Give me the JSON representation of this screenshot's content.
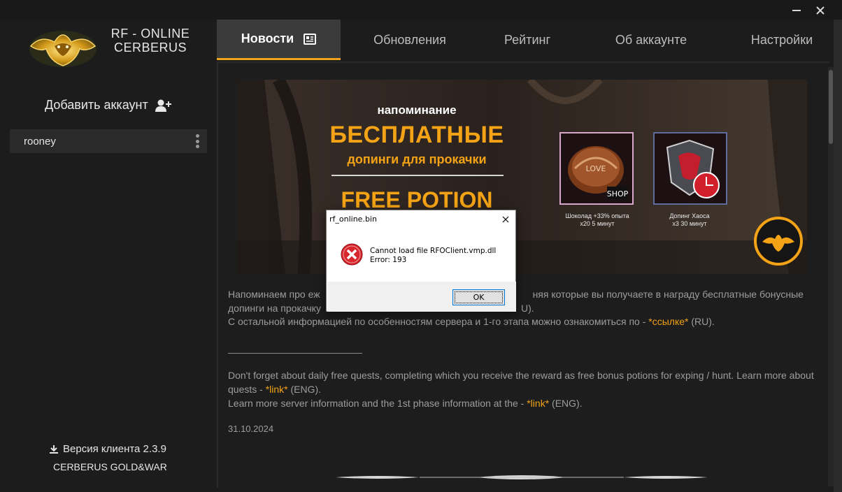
{
  "app": {
    "brand_line1": "RF - ONLINE",
    "brand_line2": "CERBERUS",
    "colors": {
      "accent": "#f3a315",
      "background": "#1c1c1c",
      "tab_active_bg": "#3b3b3b"
    }
  },
  "sidebar": {
    "add_account_label": "Добавить аккаунт",
    "accounts": [
      {
        "name": "rooney"
      }
    ],
    "version_label": "Версия клиента 2.3.9",
    "server_label": "CERBERUS GOLD&WAR"
  },
  "tabs": [
    {
      "label": "Новости",
      "active": true,
      "icon": "newspaper-icon"
    },
    {
      "label": "Обновления",
      "active": false
    },
    {
      "label": "Рейтинг",
      "active": false
    },
    {
      "label": "Об аккаунте",
      "active": false
    },
    {
      "label": "Настройки",
      "active": false
    }
  ],
  "banner": {
    "reminder": "напоминание",
    "free": "БЕСПЛАТНЫЕ",
    "subtitle": "допинги для прокачки",
    "potion": "FREE POTION",
    "item1_caption_line1": "Шоколад +33% опыта",
    "item1_caption_line2": "x20 5 минут",
    "item2_caption_line1": "Допинг Хаоса",
    "item2_caption_line2": "x3 30 минут",
    "item1_overlay_text": "LOVE",
    "item1_badge_text": "SHOP"
  },
  "news": {
    "ru_line1_visible_start": "Напоминаем про еж",
    "ru_line1_visible_end": "няя которые вы получаете в награду бесплатные бонусные",
    "ru_line2_visible_start": "допинги на прокачку",
    "ru_line2_visible_end": "U).",
    "ru_line3_text": "С остальной информацией по особенностям сервера и 1-го этапа можно ознакомиться по - ",
    "ru_line3_link": "*ссылке*",
    "ru_line3_suffix": " (RU).",
    "separator": "______________________________",
    "en_line1": "Don't forget about daily free quests, completing which you receive the reward as free bonus potions for exping / hunt. Learn more about quests - ",
    "en_link1": "*link*",
    "en_link1_suffix": " (ENG).",
    "en_line2": "Learn more server information and the 1st phase information at the - ",
    "en_link2": "*link*",
    "en_link2_suffix": " (ENG).",
    "date": "31.10.2024"
  },
  "dialog": {
    "title": "rf_online.bin",
    "message_line1": "Cannot load file RFOClient.vmp.dll",
    "message_line2": "Error: 193",
    "ok_label": "OK"
  }
}
